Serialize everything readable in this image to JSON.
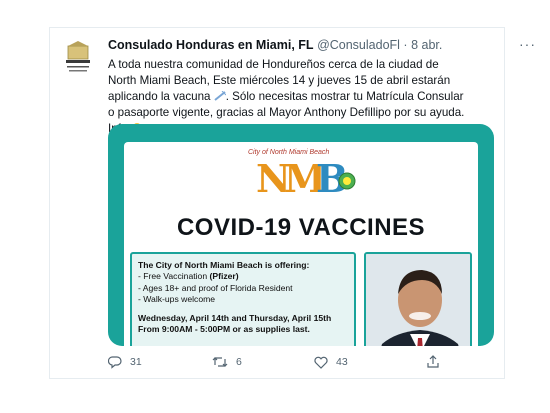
{
  "tweet": {
    "display_name": "Consulado Honduras en Miami, FL",
    "handle": "@ConsuladoFl",
    "separator": "·",
    "date": "8 abr.",
    "more_icon": "more-dots-icon",
    "text_1": "A toda nuestra comunidad de Hondureños cerca de la ciudad de North Miami Beach, Este miércoles 14 y jueves 15  de abril estarán aplicando la vacuna",
    "text_2": ". Sólo necesitas mostrar tu Matrícula Consular o pasaporte vigente, gracias al Mayor Anthony Defillipo por su ayuda. Info"
  },
  "card": {
    "city_label": "City of North Miami Beach",
    "logo_letters": [
      "N",
      "M",
      "B"
    ],
    "heading": "COVID-19 VACCINES",
    "offer_title": "The City of North Miami Beach is offering:",
    "items": [
      {
        "text": "- Free Vaccination ",
        "bold": "(Pfizer)"
      },
      {
        "text": "- Ages 18+  and proof of Florida Resident",
        "bold": ""
      },
      {
        "text": "- Walk-ups welcome",
        "bold": ""
      }
    ],
    "schedule_1": "Wednesday, April 14th and Thursday, April 15th",
    "schedule_2": "From 9:00AM - 5:00PM or as supplies last.",
    "accent": "#1aa39a"
  },
  "actions": {
    "replies": "31",
    "retweets": "6",
    "likes": "43"
  }
}
